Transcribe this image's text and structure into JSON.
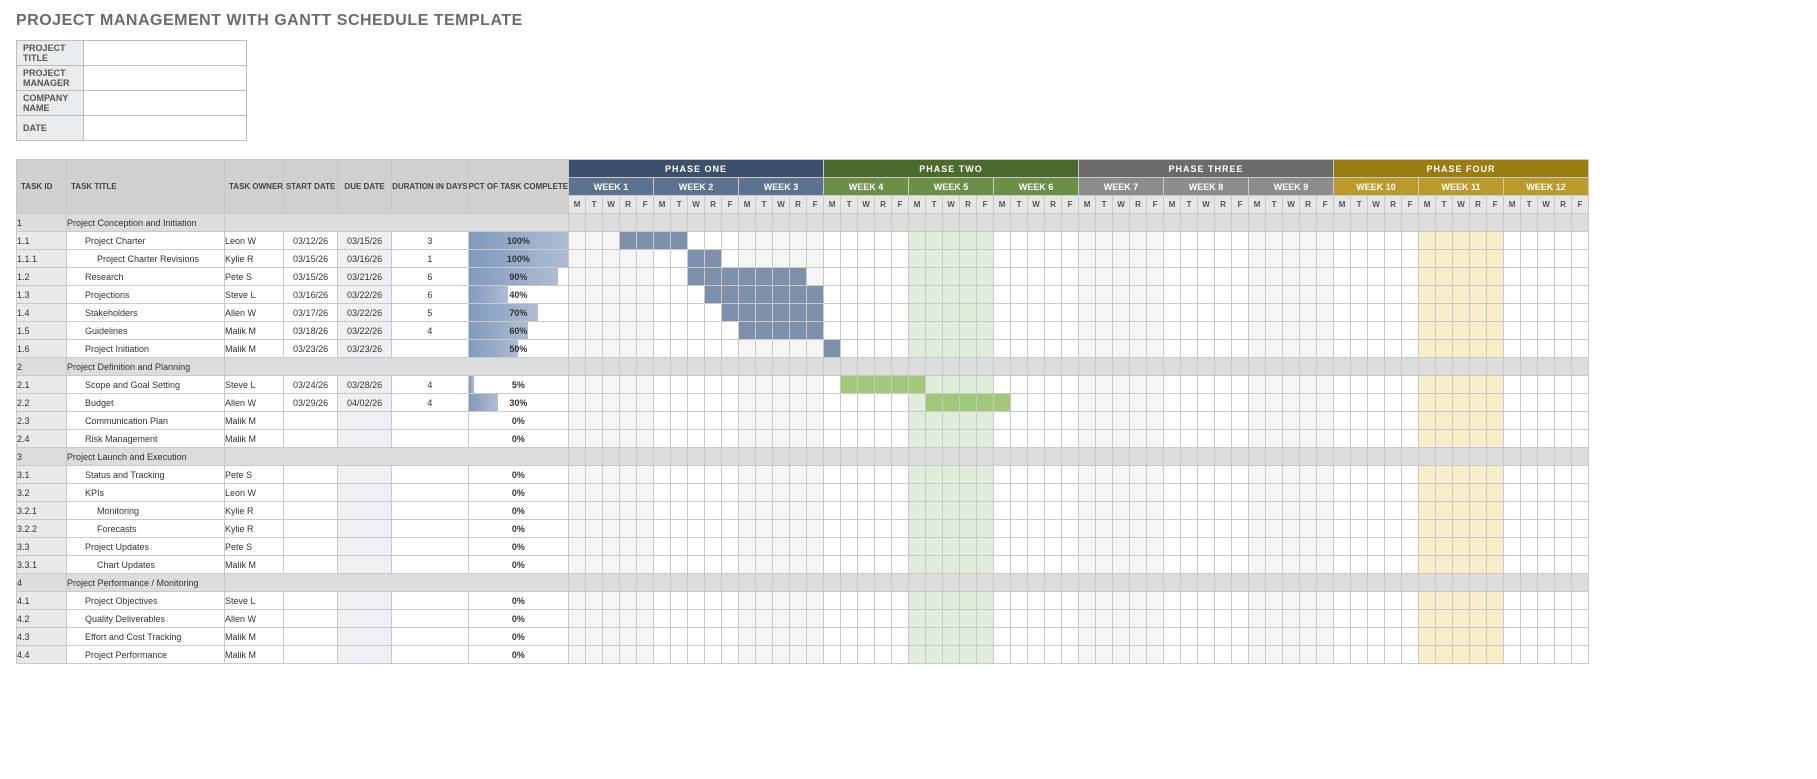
{
  "title": "PROJECT MANAGEMENT WITH GANTT SCHEDULE TEMPLATE",
  "meta_labels": [
    "PROJECT TITLE",
    "PROJECT MANAGER",
    "COMPANY NAME",
    "DATE"
  ],
  "col_headers": {
    "id": "TASK ID",
    "title": "TASK TITLE",
    "owner": "TASK OWNER",
    "start": "START DATE",
    "due": "DUE DATE",
    "dur": "DURATION IN DAYS",
    "pct": "PCT OF TASK COMPLETE"
  },
  "phases": [
    {
      "name": "PHASE ONE",
      "weeks": [
        "WEEK 1",
        "WEEK 2",
        "WEEK 3"
      ],
      "bg": "#3d506b",
      "wk_bg": "#5c728f",
      "wk_fg": "#fff",
      "day_bg": "#e6e6e6",
      "bar": "#7d90ac"
    },
    {
      "name": "PHASE TWO",
      "weeks": [
        "WEEK 4",
        "WEEK 5",
        "WEEK 6"
      ],
      "bg": "#4a6b2b",
      "wk_bg": "#6b8f44",
      "wk_fg": "#fff",
      "day_bg": "#e6e6e6",
      "bar": "#a0c97a"
    },
    {
      "name": "PHASE THREE",
      "weeks": [
        "WEEK 7",
        "WEEK 8",
        "WEEK 9"
      ],
      "bg": "#6b6b6b",
      "wk_bg": "#8c8c8c",
      "wk_fg": "#fff",
      "day_bg": "#e6e6e6",
      "bar": "#bdbdbd"
    },
    {
      "name": "PHASE FOUR",
      "weeks": [
        "WEEK 10",
        "WEEK 11",
        "WEEK 12"
      ],
      "bg": "#9a7d0f",
      "wk_bg": "#b99a2a",
      "wk_fg": "#fff",
      "day_bg": "#e6e6e6",
      "bar": "#e6cf6e"
    }
  ],
  "days": [
    "M",
    "T",
    "W",
    "R",
    "F"
  ],
  "rows": [
    {
      "id": "1",
      "title": "Project Conception and Initiation",
      "section": true
    },
    {
      "id": "1.1",
      "title": "Project Charter",
      "owner": "Leon W",
      "start": "03/12/26",
      "due": "03/15/26",
      "dur": "3",
      "pct": 100,
      "bar_start": 3,
      "bar_len": 4,
      "phase": 0,
      "indent": 1
    },
    {
      "id": "1.1.1",
      "title": "Project Charter Revisions",
      "owner": "Kylie R",
      "start": "03/15/26",
      "due": "03/16/26",
      "dur": "1",
      "pct": 100,
      "bar_start": 7,
      "bar_len": 2,
      "phase": 0,
      "indent": 2
    },
    {
      "id": "1.2",
      "title": "Research",
      "owner": "Pete S",
      "start": "03/15/26",
      "due": "03/21/26",
      "dur": "6",
      "pct": 90,
      "bar_start": 7,
      "bar_len": 7,
      "phase": 0,
      "indent": 1
    },
    {
      "id": "1.3",
      "title": "Projections",
      "owner": "Steve L",
      "start": "03/16/26",
      "due": "03/22/26",
      "dur": "6",
      "pct": 40,
      "bar_start": 8,
      "bar_len": 7,
      "phase": 0,
      "indent": 1
    },
    {
      "id": "1.4",
      "title": "Stakeholders",
      "owner": "Allen W",
      "start": "03/17/26",
      "due": "03/22/26",
      "dur": "5",
      "pct": 70,
      "bar_start": 9,
      "bar_len": 6,
      "phase": 0,
      "indent": 1
    },
    {
      "id": "1.5",
      "title": "Guidelines",
      "owner": "Malik M",
      "start": "03/18/26",
      "due": "03/22/26",
      "dur": "4",
      "pct": 60,
      "bar_start": 10,
      "bar_len": 5,
      "phase": 0,
      "indent": 1
    },
    {
      "id": "1.6",
      "title": "Project Initiation",
      "owner": "Malik M",
      "start": "03/23/26",
      "due": "03/23/26",
      "dur": "",
      "pct": 50,
      "bar_start": 15,
      "bar_len": 1,
      "phase": 0,
      "indent": 1
    },
    {
      "id": "2",
      "title": "Project Definition and Planning",
      "section": true
    },
    {
      "id": "2.1",
      "title": "Scope and Goal Setting",
      "owner": "Steve L",
      "start": "03/24/26",
      "due": "03/28/26",
      "dur": "4",
      "pct": 5,
      "bar_start": 16,
      "bar_len": 5,
      "phase": 1,
      "indent": 1
    },
    {
      "id": "2.2",
      "title": "Budget",
      "owner": "Allen W",
      "start": "03/29/26",
      "due": "04/02/26",
      "dur": "4",
      "pct": 30,
      "bar_start": 21,
      "bar_len": 5,
      "phase": 1,
      "indent": 1
    },
    {
      "id": "2.3",
      "title": "Communication Plan",
      "owner": "Malik M",
      "start": "",
      "due": "",
      "dur": "",
      "pct": 0,
      "indent": 1
    },
    {
      "id": "2.4",
      "title": "Risk Management",
      "owner": "Malik M",
      "start": "",
      "due": "",
      "dur": "",
      "pct": 0,
      "indent": 1
    },
    {
      "id": "3",
      "title": "Project Launch and Execution",
      "section": true
    },
    {
      "id": "3.1",
      "title": "Status and Tracking",
      "owner": "Pete S",
      "start": "",
      "due": "",
      "dur": "",
      "pct": 0,
      "indent": 1
    },
    {
      "id": "3.2",
      "title": "KPIs",
      "owner": "Leon W",
      "start": "",
      "due": "",
      "dur": "",
      "pct": 0,
      "indent": 1
    },
    {
      "id": "3.2.1",
      "title": "Monitoring",
      "owner": "Kylie R",
      "start": "",
      "due": "",
      "dur": "",
      "pct": 0,
      "indent": 2
    },
    {
      "id": "3.2.2",
      "title": "Forecasts",
      "owner": "Kylie R",
      "start": "",
      "due": "",
      "dur": "",
      "pct": 0,
      "indent": 2
    },
    {
      "id": "3.3",
      "title": "Project Updates",
      "owner": "Pete S",
      "start": "",
      "due": "",
      "dur": "",
      "pct": 0,
      "indent": 1
    },
    {
      "id": "3.3.1",
      "title": "Chart Updates",
      "owner": "Malik M",
      "start": "",
      "due": "",
      "dur": "",
      "pct": 0,
      "indent": 2
    },
    {
      "id": "4",
      "title": "Project Performance / Monitoring",
      "section": true
    },
    {
      "id": "4.1",
      "title": "Project Objectives",
      "owner": "Steve L",
      "start": "",
      "due": "",
      "dur": "",
      "pct": 0,
      "indent": 1
    },
    {
      "id": "4.2",
      "title": "Quality Deliverables",
      "owner": "Allen W",
      "start": "",
      "due": "",
      "dur": "",
      "pct": 0,
      "indent": 1
    },
    {
      "id": "4.3",
      "title": "Effort and Cost Tracking",
      "owner": "Malik M",
      "start": "",
      "due": "",
      "dur": "",
      "pct": 0,
      "indent": 1
    },
    {
      "id": "4.4",
      "title": "Project Performance",
      "owner": "Malik M",
      "start": "",
      "due": "",
      "dur": "",
      "pct": 0,
      "indent": 1
    }
  ],
  "shaded_weeks": {
    "1": 4,
    "3": 10
  },
  "left_widths": {
    "id": 50,
    "title": 158,
    "owner": 58,
    "start": 54,
    "due": 54,
    "dur": 54,
    "pct": 70
  }
}
